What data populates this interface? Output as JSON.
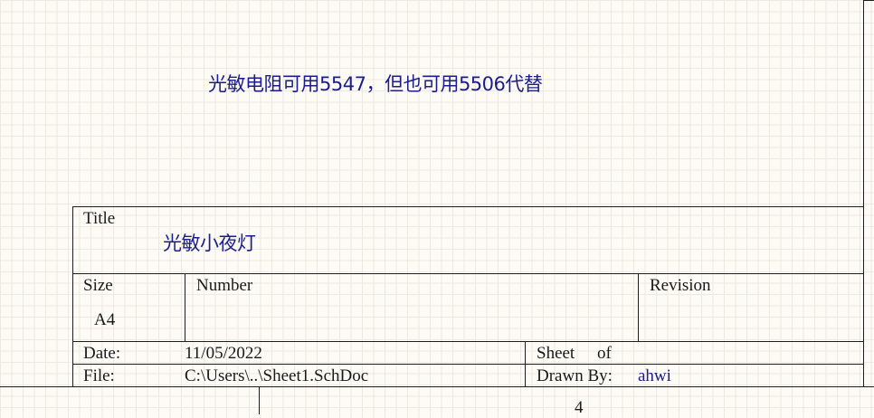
{
  "annotation": "光敏电阻可用5547，但也可用5506代替",
  "title_block": {
    "title_label": "Title",
    "title_value": "光敏小夜灯",
    "size_label": "Size",
    "size_value": "A4",
    "number_label": "Number",
    "revision_label": "Revision",
    "date_label": "Date:",
    "date_value": "11/05/2022",
    "sheet_label": "Sheet",
    "of_label": "of",
    "file_label": "File:",
    "file_value": "C:\\Users\\..\\Sheet1.SchDoc",
    "drawn_by_label": "Drawn By:",
    "drawn_by_value": "ahwi"
  },
  "border_zone_label": "4",
  "colors": {
    "background": "#fdfbf6",
    "grid": "#ece9e0",
    "text_blue": "#1c1c8a",
    "line": "#1e1e1e"
  }
}
